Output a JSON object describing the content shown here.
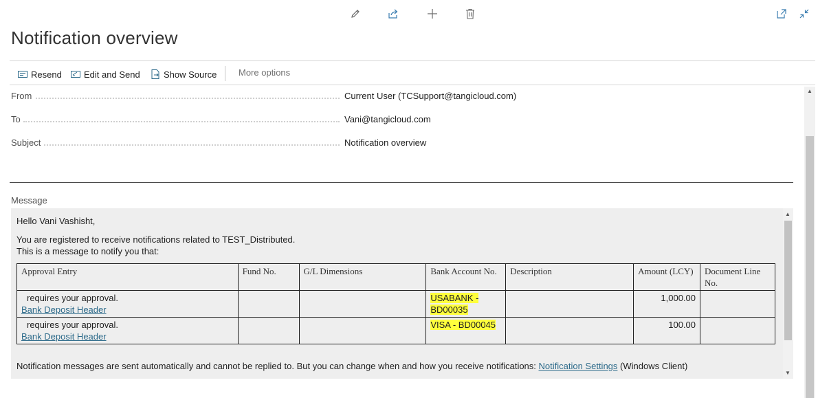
{
  "page": {
    "title": "Notification overview"
  },
  "top_actions": [
    {
      "icon": "pencil-icon"
    },
    {
      "icon": "share-icon"
    },
    {
      "icon": "plus-icon"
    },
    {
      "icon": "trash-icon"
    },
    {
      "icon": "open-in-new-window-icon"
    },
    {
      "icon": "collapse-icon"
    }
  ],
  "action_bar": {
    "resend": "Resend",
    "edit_and_send": "Edit and Send",
    "show_source": "Show Source",
    "more_options": "More options"
  },
  "fields": {
    "from": {
      "label": "From",
      "value": "Current User (TCSupport@tangicloud.com)"
    },
    "to": {
      "label": "To",
      "value": "Vani@tangicloud.com"
    },
    "subject": {
      "label": "Subject",
      "value": "Notification overview"
    }
  },
  "message": {
    "label": "Message",
    "greeting": "Hello Vani Vashisht,",
    "line1": "You are registered to receive notifications related to TEST_Distributed.",
    "line2": "This is a message to notify you that:",
    "table": {
      "headers": [
        "Approval Entry",
        "Fund No.",
        "G/L Dimensions",
        "Bank Account No.",
        "Description",
        "Amount (LCY)",
        "Document Line No."
      ],
      "rows": [
        {
          "status": "requires your approval.",
          "link": "Bank Deposit Header",
          "fund": "",
          "gl": "",
          "bank": "USABANK - BD00035",
          "description": "",
          "amount": "1,000.00",
          "doc_line": ""
        },
        {
          "status": "requires your approval.",
          "link": "Bank Deposit Header",
          "fund": "",
          "gl": "",
          "bank": "VISA - BD00045",
          "description": "",
          "amount": "100.00",
          "doc_line": ""
        }
      ]
    },
    "footer_text": "Notification messages are sent automatically and cannot be replied to. But you can change when and how you receive notifications: ",
    "footer_link": "Notification Settings",
    "footer_suffix": " (Windows Client)"
  },
  "colors": {
    "highlight": "#ffff3c",
    "link": "#2c6a8a",
    "message_bg": "#eeeeee"
  }
}
